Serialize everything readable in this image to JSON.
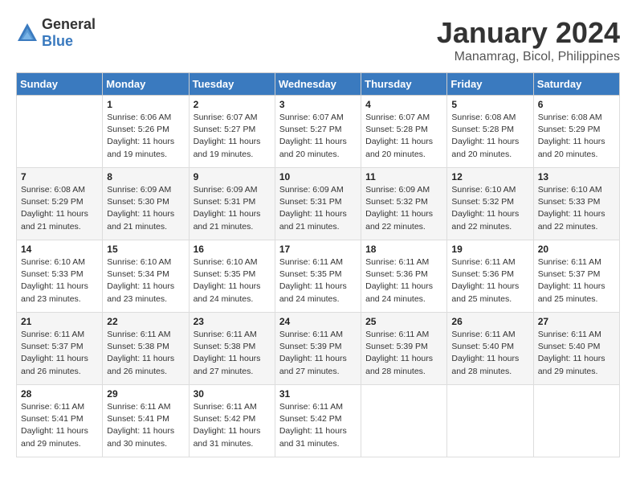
{
  "logo": {
    "text_general": "General",
    "text_blue": "Blue"
  },
  "title": "January 2024",
  "location": "Manamrag, Bicol, Philippines",
  "days_of_week": [
    "Sunday",
    "Monday",
    "Tuesday",
    "Wednesday",
    "Thursday",
    "Friday",
    "Saturday"
  ],
  "weeks": [
    [
      {
        "day": "",
        "sunrise": "",
        "sunset": "",
        "daylight": ""
      },
      {
        "day": "1",
        "sunrise": "Sunrise: 6:06 AM",
        "sunset": "Sunset: 5:26 PM",
        "daylight": "Daylight: 11 hours and 19 minutes."
      },
      {
        "day": "2",
        "sunrise": "Sunrise: 6:07 AM",
        "sunset": "Sunset: 5:27 PM",
        "daylight": "Daylight: 11 hours and 19 minutes."
      },
      {
        "day": "3",
        "sunrise": "Sunrise: 6:07 AM",
        "sunset": "Sunset: 5:27 PM",
        "daylight": "Daylight: 11 hours and 20 minutes."
      },
      {
        "day": "4",
        "sunrise": "Sunrise: 6:07 AM",
        "sunset": "Sunset: 5:28 PM",
        "daylight": "Daylight: 11 hours and 20 minutes."
      },
      {
        "day": "5",
        "sunrise": "Sunrise: 6:08 AM",
        "sunset": "Sunset: 5:28 PM",
        "daylight": "Daylight: 11 hours and 20 minutes."
      },
      {
        "day": "6",
        "sunrise": "Sunrise: 6:08 AM",
        "sunset": "Sunset: 5:29 PM",
        "daylight": "Daylight: 11 hours and 20 minutes."
      }
    ],
    [
      {
        "day": "7",
        "sunrise": "Sunrise: 6:08 AM",
        "sunset": "Sunset: 5:29 PM",
        "daylight": "Daylight: 11 hours and 21 minutes."
      },
      {
        "day": "8",
        "sunrise": "Sunrise: 6:09 AM",
        "sunset": "Sunset: 5:30 PM",
        "daylight": "Daylight: 11 hours and 21 minutes."
      },
      {
        "day": "9",
        "sunrise": "Sunrise: 6:09 AM",
        "sunset": "Sunset: 5:31 PM",
        "daylight": "Daylight: 11 hours and 21 minutes."
      },
      {
        "day": "10",
        "sunrise": "Sunrise: 6:09 AM",
        "sunset": "Sunset: 5:31 PM",
        "daylight": "Daylight: 11 hours and 21 minutes."
      },
      {
        "day": "11",
        "sunrise": "Sunrise: 6:09 AM",
        "sunset": "Sunset: 5:32 PM",
        "daylight": "Daylight: 11 hours and 22 minutes."
      },
      {
        "day": "12",
        "sunrise": "Sunrise: 6:10 AM",
        "sunset": "Sunset: 5:32 PM",
        "daylight": "Daylight: 11 hours and 22 minutes."
      },
      {
        "day": "13",
        "sunrise": "Sunrise: 6:10 AM",
        "sunset": "Sunset: 5:33 PM",
        "daylight": "Daylight: 11 hours and 22 minutes."
      }
    ],
    [
      {
        "day": "14",
        "sunrise": "Sunrise: 6:10 AM",
        "sunset": "Sunset: 5:33 PM",
        "daylight": "Daylight: 11 hours and 23 minutes."
      },
      {
        "day": "15",
        "sunrise": "Sunrise: 6:10 AM",
        "sunset": "Sunset: 5:34 PM",
        "daylight": "Daylight: 11 hours and 23 minutes."
      },
      {
        "day": "16",
        "sunrise": "Sunrise: 6:10 AM",
        "sunset": "Sunset: 5:35 PM",
        "daylight": "Daylight: 11 hours and 24 minutes."
      },
      {
        "day": "17",
        "sunrise": "Sunrise: 6:11 AM",
        "sunset": "Sunset: 5:35 PM",
        "daylight": "Daylight: 11 hours and 24 minutes."
      },
      {
        "day": "18",
        "sunrise": "Sunrise: 6:11 AM",
        "sunset": "Sunset: 5:36 PM",
        "daylight": "Daylight: 11 hours and 24 minutes."
      },
      {
        "day": "19",
        "sunrise": "Sunrise: 6:11 AM",
        "sunset": "Sunset: 5:36 PM",
        "daylight": "Daylight: 11 hours and 25 minutes."
      },
      {
        "day": "20",
        "sunrise": "Sunrise: 6:11 AM",
        "sunset": "Sunset: 5:37 PM",
        "daylight": "Daylight: 11 hours and 25 minutes."
      }
    ],
    [
      {
        "day": "21",
        "sunrise": "Sunrise: 6:11 AM",
        "sunset": "Sunset: 5:37 PM",
        "daylight": "Daylight: 11 hours and 26 minutes."
      },
      {
        "day": "22",
        "sunrise": "Sunrise: 6:11 AM",
        "sunset": "Sunset: 5:38 PM",
        "daylight": "Daylight: 11 hours and 26 minutes."
      },
      {
        "day": "23",
        "sunrise": "Sunrise: 6:11 AM",
        "sunset": "Sunset: 5:38 PM",
        "daylight": "Daylight: 11 hours and 27 minutes."
      },
      {
        "day": "24",
        "sunrise": "Sunrise: 6:11 AM",
        "sunset": "Sunset: 5:39 PM",
        "daylight": "Daylight: 11 hours and 27 minutes."
      },
      {
        "day": "25",
        "sunrise": "Sunrise: 6:11 AM",
        "sunset": "Sunset: 5:39 PM",
        "daylight": "Daylight: 11 hours and 28 minutes."
      },
      {
        "day": "26",
        "sunrise": "Sunrise: 6:11 AM",
        "sunset": "Sunset: 5:40 PM",
        "daylight": "Daylight: 11 hours and 28 minutes."
      },
      {
        "day": "27",
        "sunrise": "Sunrise: 6:11 AM",
        "sunset": "Sunset: 5:40 PM",
        "daylight": "Daylight: 11 hours and 29 minutes."
      }
    ],
    [
      {
        "day": "28",
        "sunrise": "Sunrise: 6:11 AM",
        "sunset": "Sunset: 5:41 PM",
        "daylight": "Daylight: 11 hours and 29 minutes."
      },
      {
        "day": "29",
        "sunrise": "Sunrise: 6:11 AM",
        "sunset": "Sunset: 5:41 PM",
        "daylight": "Daylight: 11 hours and 30 minutes."
      },
      {
        "day": "30",
        "sunrise": "Sunrise: 6:11 AM",
        "sunset": "Sunset: 5:42 PM",
        "daylight": "Daylight: 11 hours and 31 minutes."
      },
      {
        "day": "31",
        "sunrise": "Sunrise: 6:11 AM",
        "sunset": "Sunset: 5:42 PM",
        "daylight": "Daylight: 11 hours and 31 minutes."
      },
      {
        "day": "",
        "sunrise": "",
        "sunset": "",
        "daylight": ""
      },
      {
        "day": "",
        "sunrise": "",
        "sunset": "",
        "daylight": ""
      },
      {
        "day": "",
        "sunrise": "",
        "sunset": "",
        "daylight": ""
      }
    ]
  ]
}
